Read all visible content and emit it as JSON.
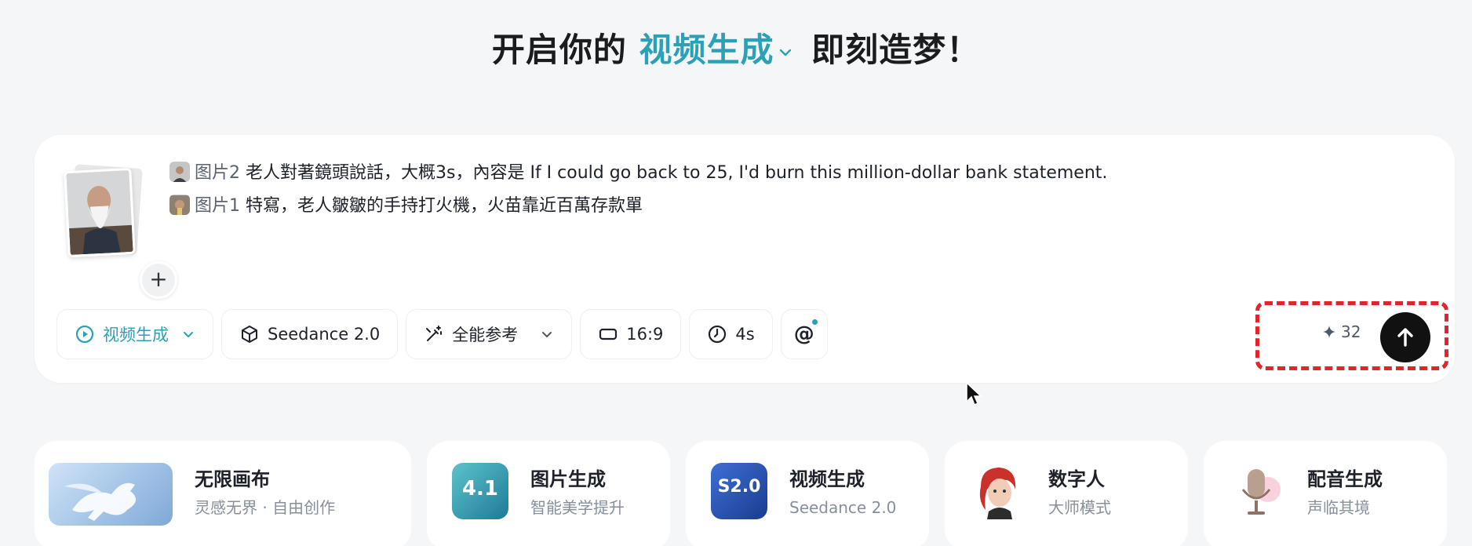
{
  "headline": {
    "prefix": "开启你的",
    "mode": "视频生成",
    "suffix": "即刻造梦！"
  },
  "prompt": {
    "lines": [
      {
        "ref": "图片2",
        "text": "老人對著鏡頭說話，大概3s，內容是 If I could go back to 25, I'd burn this million-dollar bank statement."
      },
      {
        "ref": "图片1",
        "text": "特寫，老人皺皺的手持打火機，火苗靠近百萬存款單"
      }
    ],
    "add_label": "+"
  },
  "toolbar": {
    "mode_label": "视频生成",
    "model_label": "Seedance 2.0",
    "reference_label": "全能参考",
    "ratio_label": "16:9",
    "duration_label": "4s",
    "mention_label": "@"
  },
  "credits": {
    "value": "32"
  },
  "features": [
    {
      "title": "无限画布",
      "subtitle": "灵感无界 · 自由创作",
      "icon": "pegasus-icon"
    },
    {
      "title": "图片生成",
      "subtitle": "智能美学提升",
      "icon": "image-4.1-icon",
      "badge": "4.1"
    },
    {
      "title": "视频生成",
      "subtitle": "Seedance 2.0",
      "icon": "video-s2.0-icon",
      "badge": "S2.0"
    },
    {
      "title": "数字人",
      "subtitle": "大师模式",
      "icon": "digital-human-icon"
    },
    {
      "title": "配音生成",
      "subtitle": "声临其境",
      "icon": "microphone-icon"
    }
  ],
  "colors": {
    "accent": "#2aa1b6",
    "highlight_border": "#e0262b",
    "send_button": "#111111"
  }
}
